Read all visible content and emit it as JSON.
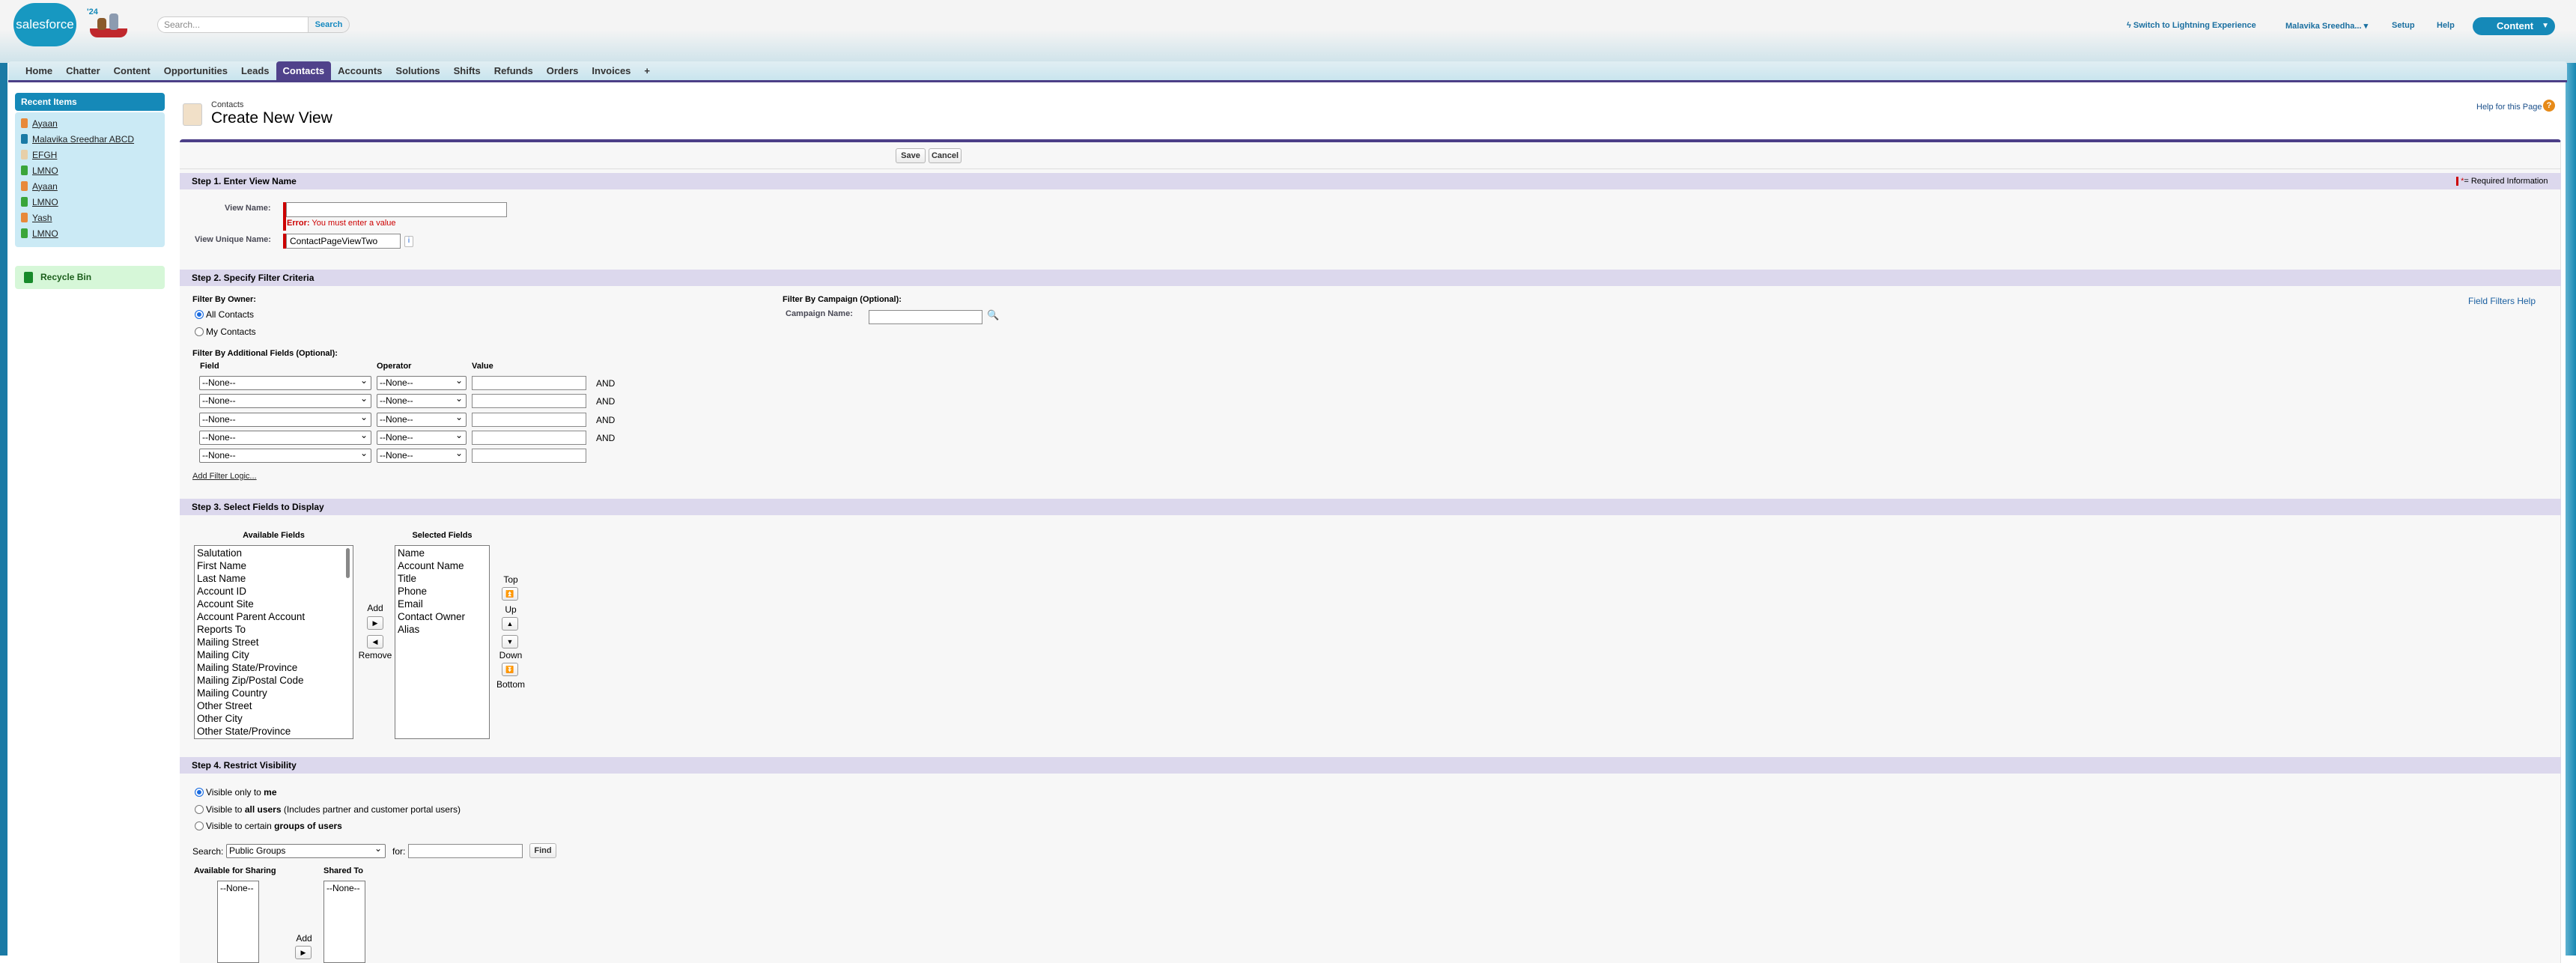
{
  "header": {
    "logo_text": "salesforce",
    "mascot_text": "'24",
    "search_placeholder": "Search...",
    "search_button": "Search",
    "switch_lightning": "Switch to Lightning Experience",
    "user_menu": "Malavika Sreedha...",
    "setup": "Setup",
    "help": "Help",
    "app_menu": "Content"
  },
  "tabs": [
    "Home",
    "Chatter",
    "Content",
    "Opportunities",
    "Leads",
    "Contacts",
    "Accounts",
    "Solutions",
    "Shifts",
    "Refunds",
    "Orders",
    "Invoices",
    "+"
  ],
  "active_tab": "Contacts",
  "sidebar": {
    "recent_title": "Recent Items",
    "recent_items": [
      {
        "label": "Ayaan",
        "icon": "account-icon"
      },
      {
        "label": "Malavika Sreedhar ABCD",
        "icon": "user-icon"
      },
      {
        "label": "EFGH",
        "icon": "contact-icon"
      },
      {
        "label": "LMNO",
        "icon": "lead-icon"
      },
      {
        "label": "Ayaan",
        "icon": "account-icon"
      },
      {
        "label": "LMNO",
        "icon": "lead-icon"
      },
      {
        "label": "Yash",
        "icon": "account-icon"
      },
      {
        "label": "LMNO",
        "icon": "lead-icon"
      }
    ],
    "recycle_bin": "Recycle Bin"
  },
  "page": {
    "breadcrumb": "Contacts",
    "title": "Create New View",
    "help_link": "Help for this Page",
    "help_icon": "?",
    "save": "Save",
    "cancel": "Cancel",
    "required_info": "= Required Information"
  },
  "step1": {
    "title": "Step 1. Enter View Name",
    "view_name_label": "View Name:",
    "view_name_value": "",
    "error_prefix": "Error:",
    "error_text": "You must enter a value",
    "unique_label": "View Unique Name:",
    "unique_value": "ContactPageViewTwo",
    "info_icon": "i"
  },
  "step2": {
    "title": "Step 2. Specify Filter Criteria",
    "owner_label": "Filter By Owner:",
    "owner_options": [
      "All Contacts",
      "My Contacts"
    ],
    "owner_selected": "All Contacts",
    "campaign_label": "Filter By Campaign (Optional):",
    "campaign_name_label": "Campaign Name:",
    "campaign_value": "",
    "field_filters_help": "Field Filters Help",
    "help_icon": "?",
    "additional_label": "Filter By Additional Fields (Optional):",
    "col_field": "Field",
    "col_operator": "Operator",
    "col_value": "Value",
    "rows": [
      {
        "field": "--None--",
        "operator": "--None--",
        "value": "",
        "conj": "AND"
      },
      {
        "field": "--None--",
        "operator": "--None--",
        "value": "",
        "conj": "AND"
      },
      {
        "field": "--None--",
        "operator": "--None--",
        "value": "",
        "conj": "AND"
      },
      {
        "field": "--None--",
        "operator": "--None--",
        "value": "",
        "conj": "AND"
      },
      {
        "field": "--None--",
        "operator": "--None--",
        "value": "",
        "conj": ""
      }
    ],
    "add_filter_logic": "Add Filter Logic..."
  },
  "step3": {
    "title": "Step 3. Select Fields to Display",
    "available_label": "Available Fields",
    "available": [
      "Salutation",
      "First Name",
      "Last Name",
      "Account ID",
      "Account Site",
      "Account Parent Account",
      "Reports To",
      "Mailing Street",
      "Mailing City",
      "Mailing State/Province",
      "Mailing Zip/Postal Code",
      "Mailing Country",
      "Other Street",
      "Other City",
      "Other State/Province"
    ],
    "selected_label": "Selected Fields",
    "selected": [
      "Name",
      "Account Name",
      "Title",
      "Phone",
      "Email",
      "Contact Owner Alias"
    ],
    "add": "Add",
    "remove": "Remove",
    "top": "Top",
    "up": "Up",
    "down": "Down",
    "bottom": "Bottom"
  },
  "step4": {
    "title": "Step 4. Restrict Visibility",
    "options": [
      {
        "pre": "Visible only to ",
        "bold": "me",
        "post": ""
      },
      {
        "pre": "Visible to ",
        "bold": "all users",
        "post": " (Includes partner and customer portal users)"
      },
      {
        "pre": "Visible to certain ",
        "bold": "groups of users",
        "post": ""
      }
    ],
    "selected_index": 0,
    "search_label": "Search:",
    "search_type": "Public Groups",
    "for_label": "for:",
    "for_value": "",
    "find": "Find",
    "available_label": "Available for Sharing",
    "available": [
      "--None--"
    ],
    "shared_label": "Shared To",
    "shared": [
      "--None--"
    ],
    "add": "Add"
  }
}
